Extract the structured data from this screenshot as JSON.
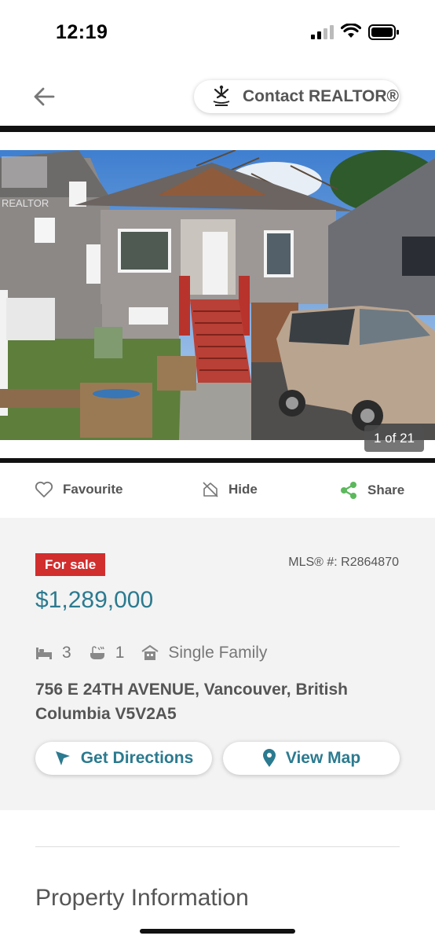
{
  "status": {
    "time": "12:19"
  },
  "header": {
    "contact_label": "Contact REALTOR®"
  },
  "photo": {
    "counter": "1 of 21",
    "watermark": "REALTOR"
  },
  "actions": {
    "favourite": "Favourite",
    "hide": "Hide",
    "share": "Share"
  },
  "listing": {
    "status_badge": "For sale",
    "mls": "MLS® #: R2864870",
    "price": "$1,289,000",
    "bedrooms": "3",
    "bathrooms": "1",
    "property_type": "Single Family",
    "address": "756 E 24TH AVENUE, Vancouver, British Columbia V5V2A5"
  },
  "buttons": {
    "directions": "Get Directions",
    "map": "View Map"
  },
  "sections": {
    "property_info": "Property Information"
  },
  "colors": {
    "accent": "#2b7a8f",
    "badge": "#d12e2e",
    "share_icon": "#5cb85c"
  }
}
